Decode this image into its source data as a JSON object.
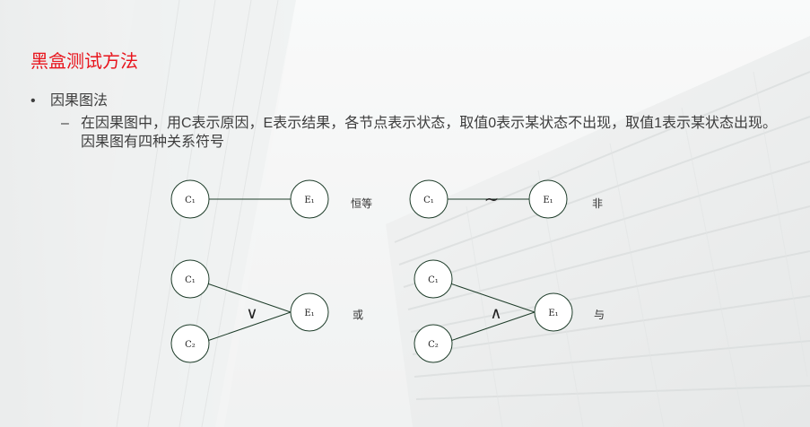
{
  "slide": {
    "title": "黑盒测试方法",
    "bullet": {
      "marker": "•",
      "text": "因果图法"
    },
    "sub_bullet": {
      "marker": "–",
      "text": "在因果图中，用C表示原因，E表示结果，各节点表示状态，取值0表示某状态不出现，取值1表示某状态出现。因果图有四种关系符号"
    }
  },
  "diagram": {
    "identity": {
      "cause": "C₁",
      "effect": "E₁",
      "label": "恒等"
    },
    "not": {
      "cause": "C₁",
      "effect": "E₁",
      "symbol": "~",
      "label": "非"
    },
    "or": {
      "cause1": "C₁",
      "cause2": "C₂",
      "effect": "E₁",
      "symbol": "∨",
      "label": "或"
    },
    "and": {
      "cause1": "C₁",
      "cause2": "C₂",
      "effect": "E₁",
      "symbol": "∧",
      "label": "与"
    }
  },
  "colors": {
    "title": "#e8141c",
    "text": "#3d3d3d",
    "node_border": "#1e3d2a"
  }
}
